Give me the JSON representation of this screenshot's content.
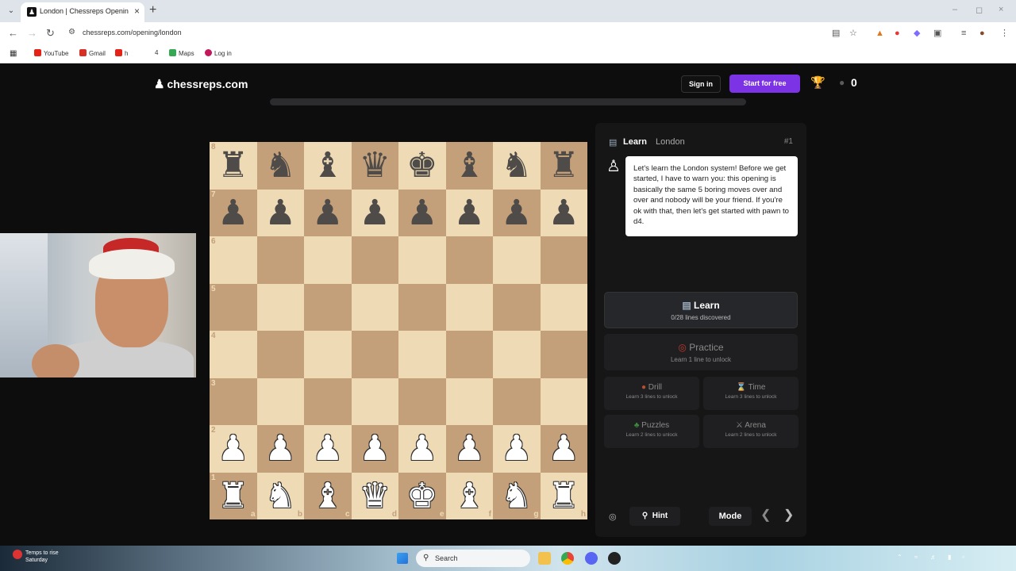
{
  "browser": {
    "tab_title": "London | Chessreps Opening Tr",
    "url": "chessreps.com/opening/london",
    "bookmarks": [
      {
        "label": "YouTube",
        "color": "#e62117"
      },
      {
        "label": "Gmail",
        "color": "#d93025"
      },
      {
        "label": "h",
        "color": "#e62117"
      },
      {
        "label": "4",
        "color": ""
      },
      {
        "label": "Maps",
        "color": "#34a853"
      },
      {
        "label": "Log in",
        "color": "#c2185b"
      }
    ]
  },
  "site": {
    "logo_text": "chessreps.com",
    "sign_in_label": "Sign in",
    "start_label": "Start for free",
    "gem_count": "0",
    "accent_color": "#7c33e6",
    "progress_fraction": 0
  },
  "board": {
    "ranks": [
      "8",
      "7",
      "6",
      "5",
      "4",
      "3",
      "2",
      "1"
    ],
    "files": [
      "a",
      "b",
      "c",
      "d",
      "e",
      "f",
      "g",
      "h"
    ],
    "position": [
      [
        "br",
        "bn",
        "bb",
        "bq",
        "bk",
        "bb",
        "bn",
        "br"
      ],
      [
        "bp",
        "bp",
        "bp",
        "bp",
        "bp",
        "bp",
        "bp",
        "bp"
      ],
      [
        "",
        "",
        "",
        "",
        "",
        "",
        "",
        ""
      ],
      [
        "",
        "",
        "",
        "",
        "",
        "",
        "",
        ""
      ],
      [
        "",
        "",
        "",
        "",
        "",
        "",
        "",
        ""
      ],
      [
        "",
        "",
        "",
        "",
        "",
        "",
        "",
        ""
      ],
      [
        "wp",
        "wp",
        "wp",
        "wp",
        "wp",
        "wp",
        "wp",
        "wp"
      ],
      [
        "wr",
        "wn",
        "wb",
        "wq",
        "wk",
        "wb",
        "wn",
        "wr"
      ]
    ],
    "light_color": "#eedbb6",
    "dark_color": "#c4a07a"
  },
  "panel": {
    "header_mode": "Learn",
    "header_opening": "London",
    "header_number": "#1",
    "coach_message": "Let's learn the London system! Before we get started, I have to warn you: this opening is basically the same 5 boring moves over and over and nobody will be your friend. If you're ok with that, then let's get started with pawn to d4.",
    "learn": {
      "title": "Learn",
      "subtitle": "0/28 lines discovered"
    },
    "practice": {
      "title": "Practice",
      "subtitle": "Learn 1 line to unlock"
    },
    "drill": {
      "title": "Drill",
      "subtitle": "Learn 3 lines to unlock"
    },
    "time": {
      "title": "Time",
      "subtitle": "Learn 3 lines to unlock"
    },
    "puzzles": {
      "title": "Puzzles",
      "subtitle": "Learn 2 lines to unlock"
    },
    "arena": {
      "title": "Arena",
      "subtitle": "Learn 2 lines to unlock"
    },
    "hint_label": "Hint",
    "mode_label": "Mode"
  },
  "taskbar": {
    "weather_line1": "Temps to rise",
    "weather_line2": "Saturday",
    "search_placeholder": "Search"
  }
}
